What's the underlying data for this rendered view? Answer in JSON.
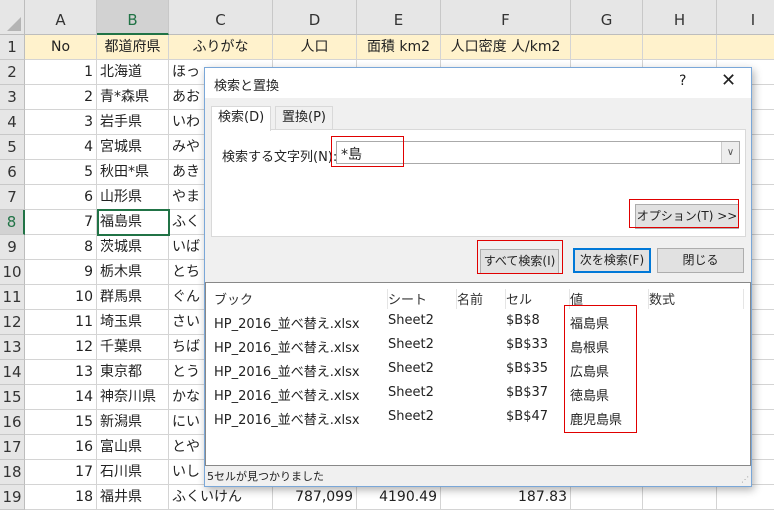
{
  "columns": [
    "A",
    "B",
    "C",
    "D",
    "E",
    "F",
    "G",
    "H",
    "I"
  ],
  "header_row": {
    "row": "1",
    "cells": [
      "No",
      "都道府県",
      "ふりがな",
      "人口",
      "面積 km2",
      "人口密度 人/km2"
    ]
  },
  "rows": [
    {
      "row": "2",
      "no": "1",
      "pref": "北海道",
      "kana": "ほっ"
    },
    {
      "row": "3",
      "no": "2",
      "pref": "青*森県",
      "kana": "あお"
    },
    {
      "row": "4",
      "no": "3",
      "pref": "岩手県",
      "kana": "いわ"
    },
    {
      "row": "5",
      "no": "4",
      "pref": "宮城県",
      "kana": "みや"
    },
    {
      "row": "6",
      "no": "5",
      "pref": "秋田*県",
      "kana": "あき"
    },
    {
      "row": "7",
      "no": "6",
      "pref": "山形県",
      "kana": "やま"
    },
    {
      "row": "8",
      "no": "7",
      "pref": "福島県",
      "kana": "ふく"
    },
    {
      "row": "9",
      "no": "8",
      "pref": "茨城県",
      "kana": "いば"
    },
    {
      "row": "10",
      "no": "9",
      "pref": "栃木県",
      "kana": "とち"
    },
    {
      "row": "11",
      "no": "10",
      "pref": "群馬県",
      "kana": "ぐん"
    },
    {
      "row": "12",
      "no": "11",
      "pref": "埼玉県",
      "kana": "さい"
    },
    {
      "row": "13",
      "no": "12",
      "pref": "千葉県",
      "kana": "ちば"
    },
    {
      "row": "14",
      "no": "13",
      "pref": "東京都",
      "kana": "とう"
    },
    {
      "row": "15",
      "no": "14",
      "pref": "神奈川県",
      "kana": "かな"
    },
    {
      "row": "16",
      "no": "15",
      "pref": "新潟県",
      "kana": "にい"
    },
    {
      "row": "17",
      "no": "16",
      "pref": "富山県",
      "kana": "とや"
    },
    {
      "row": "18",
      "no": "17",
      "pref": "石川県",
      "kana": "いし"
    },
    {
      "row": "19",
      "no": "18",
      "pref": "福井県",
      "kana": "ふくいけん",
      "pop": "787,099",
      "area": "4190.49",
      "density": "187.83"
    }
  ],
  "dialog": {
    "title": "検索と置換",
    "help": "?",
    "close": "✕",
    "tab_find": "検索(D)",
    "tab_replace": "置換(P)",
    "find_label": "検索する文字列(N):",
    "find_value": "*島",
    "options_button": "オプション(T) >>",
    "find_all_button": "すべて検索(I)",
    "find_next_button": "次を検索(F)",
    "close_button": "閉じる",
    "result_headers": [
      "ブック",
      "シート",
      "名前",
      "セル",
      "値",
      "数式"
    ],
    "results": [
      {
        "book": "HP_2016_並べ替え.xlsx",
        "sheet": "Sheet2",
        "name": "",
        "cell": "$B$8",
        "value": "福島県",
        "formula": ""
      },
      {
        "book": "HP_2016_並べ替え.xlsx",
        "sheet": "Sheet2",
        "name": "",
        "cell": "$B$33",
        "value": "島根県",
        "formula": ""
      },
      {
        "book": "HP_2016_並べ替え.xlsx",
        "sheet": "Sheet2",
        "name": "",
        "cell": "$B$35",
        "value": "広島県",
        "formula": ""
      },
      {
        "book": "HP_2016_並べ替え.xlsx",
        "sheet": "Sheet2",
        "name": "",
        "cell": "$B$37",
        "value": "徳島県",
        "formula": ""
      },
      {
        "book": "HP_2016_並べ替え.xlsx",
        "sheet": "Sheet2",
        "name": "",
        "cell": "$B$47",
        "value": "鹿児島県",
        "formula": ""
      }
    ],
    "status": "5セルが見つかりました"
  }
}
